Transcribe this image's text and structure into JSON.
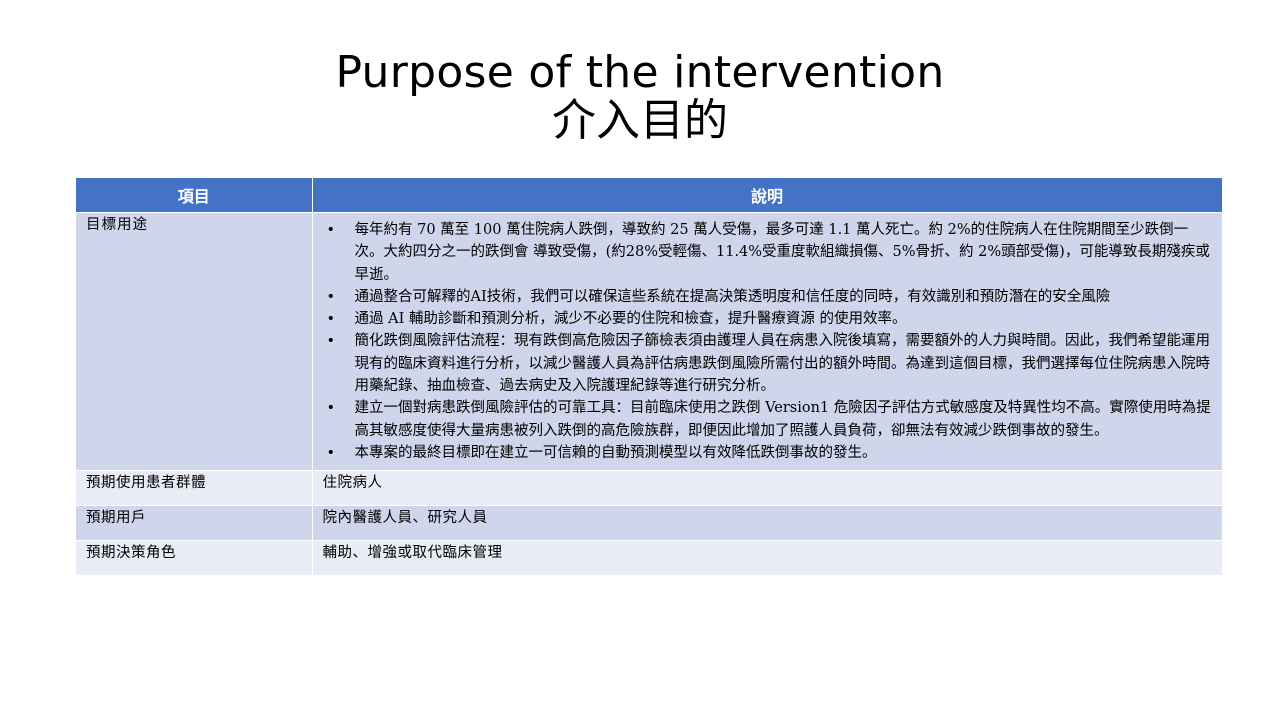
{
  "title": {
    "en": "Purpose of the intervention",
    "zh": "介入目的"
  },
  "table": {
    "headers": [
      "項目",
      "說明"
    ],
    "goal": {
      "label": "目標用途",
      "bullets": [
        "每年約有 70 萬至 100 萬住院病人跌倒，導致約 25 萬人受傷，最多可達 1.1 萬人死亡。約 2%的住院病人在住院期間至少跌倒一次。大約四分之一的跌倒會 導致受傷，(約28%受輕傷、11.4%受重度軟組織損傷、5%骨折、約 2%頭部受傷)，可能導致長期殘疾或早逝。",
        "通過整合可解釋的AI技術，我們可以確保這些系統在提高決策透明度和信任度的同時，有效識別和預防潛在的安全風險",
        "通過 AI 輔助診斷和預測分析，減少不必要的住院和檢查，提升醫療資源 的使用效率。",
        "簡化跌倒風險評估流程：現有跌倒高危險因子篩檢表須由護理人員在病患入院後填寫，需要額外的人力與時間。因此，我們希望能運用現有的臨床資料進行分析，以減少醫護人員為評估病患跌倒風險所需付出的額外時間。為達到這個目標，我們選擇每位住院病患入院時用藥紀錄、抽血檢查、過去病史及入院護理紀錄等進行研究分析。",
        "建立一個對病患跌倒風險評估的可靠工具：目前臨床使用之跌倒 Version1 危險因子評估方式敏感度及特異性均不高。實際使用時為提高其敏感度使得大量病患被列入跌倒的高危險族群，即便因此增加了照護人員負荷，卻無法有效減少跌倒事故的發生。",
        "本專案的最終目標即在建立一可信賴的自動預測模型以有效降低跌倒事故的發生。"
      ],
      "bullet_symbol": "•"
    },
    "rows": [
      {
        "label": "預期使用患者群體",
        "value": "住院病人"
      },
      {
        "label": "預期用戶",
        "value": "院內醫護人員、研究人員"
      },
      {
        "label": "預期決策角色",
        "value": "輔助、增強或取代臨床管理"
      }
    ]
  },
  "colors": {
    "header_bg": "#4472c4",
    "row_dark": "#cfd5ea",
    "row_light": "#e9ebf5"
  }
}
